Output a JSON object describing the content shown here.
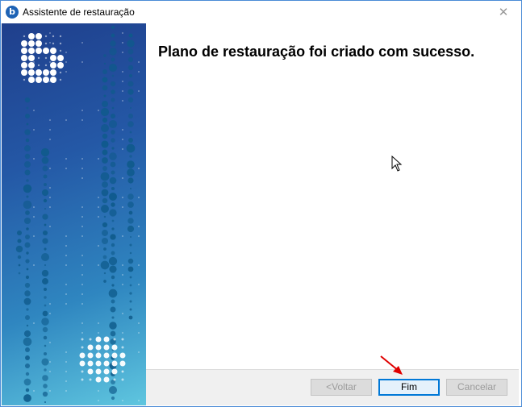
{
  "window": {
    "title": "Assistente de restauração",
    "app_icon_glyph": "b",
    "close_glyph": "✕"
  },
  "main": {
    "heading": "Plano de restauração foi criado com sucesso."
  },
  "buttons": {
    "back": "<Voltar",
    "finish": "Fim",
    "cancel": "Cancelar"
  },
  "colors": {
    "accent": "#0078d7",
    "annotation_arrow": "#e00000",
    "panel_top": "#1f3f8c",
    "panel_bottom": "#5fc6df"
  }
}
